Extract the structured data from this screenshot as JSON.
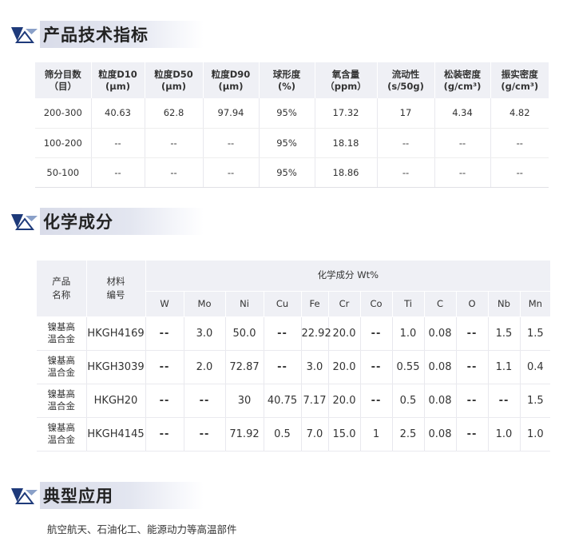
{
  "sections": {
    "spec": {
      "title": "产品技术指标"
    },
    "chem": {
      "title": "化学成分"
    },
    "app": {
      "title": "典型应用"
    }
  },
  "spec_table": {
    "headers": [
      [
        "筛分目数",
        "（目）"
      ],
      [
        "粒度D10",
        "(μm)"
      ],
      [
        "粒度D50",
        "(μm)"
      ],
      [
        "粒度D90",
        "(μm)"
      ],
      [
        "球形度",
        "(%)"
      ],
      [
        "氧含量",
        "（ppm）"
      ],
      [
        "流动性",
        "(s/50g)"
      ],
      [
        "松装密度",
        "(g/cm³)"
      ],
      [
        "振实密度",
        "(g/cm³)"
      ]
    ],
    "rows": [
      [
        "200-300",
        "40.63",
        "62.8",
        "97.94",
        "95%",
        "17.32",
        "17",
        "4.34",
        "4.82"
      ],
      [
        "100-200",
        "--",
        "--",
        "--",
        "95%",
        "18.18",
        "--",
        "--",
        "--"
      ],
      [
        "50-100",
        "--",
        "--",
        "--",
        "95%",
        "18.86",
        "--",
        "--",
        "--"
      ]
    ]
  },
  "chem_table": {
    "product_header": [
      "产品",
      "名称"
    ],
    "material_header": [
      "材料",
      "编号"
    ],
    "group_header": "化学成分 Wt%",
    "elements": [
      "W",
      "Mo",
      "Ni",
      "Cu",
      "Fe",
      "Cr",
      "Co",
      "Ti",
      "C",
      "O",
      "Nb",
      "Mn"
    ],
    "rows": [
      {
        "name": [
          "镍基高",
          "温合金"
        ],
        "code": "HKGH4169",
        "values": [
          "--",
          "3.0",
          "50.0",
          "--",
          "22.92",
          "20.0",
          "--",
          "1.0",
          "0.08",
          "--",
          "1.5",
          "1.5"
        ]
      },
      {
        "name": [
          "镍基高",
          "温合金"
        ],
        "code": "HKGH3039",
        "values": [
          "--",
          "2.0",
          "72.87",
          "--",
          "3.0",
          "20.0",
          "--",
          "0.55",
          "0.08",
          "--",
          "1.1",
          "0.4"
        ]
      },
      {
        "name": [
          "镍基高",
          "温合金"
        ],
        "code": "HKGH20",
        "values": [
          "--",
          "--",
          "30",
          "40.75",
          "7.17",
          "20.0",
          "--",
          "0.5",
          "0.08",
          "--",
          "--",
          "1.5"
        ]
      },
      {
        "name": [
          "镍基高",
          "温合金"
        ],
        "code": "HKGH4145",
        "values": [
          "--",
          "--",
          "71.92",
          "0.5",
          "7.0",
          "15.0",
          "1",
          "2.5",
          "0.08",
          "--",
          "1.0",
          "1.0"
        ]
      }
    ]
  },
  "application": {
    "text": "航空航天、石油化工、能源动力等高温部件"
  },
  "colors": {
    "logo_dark": "#1e3a7a",
    "logo_light": "#8aa0c8",
    "header_bg": "#dfe2ed",
    "table_header_bg": "#eff0f5"
  }
}
